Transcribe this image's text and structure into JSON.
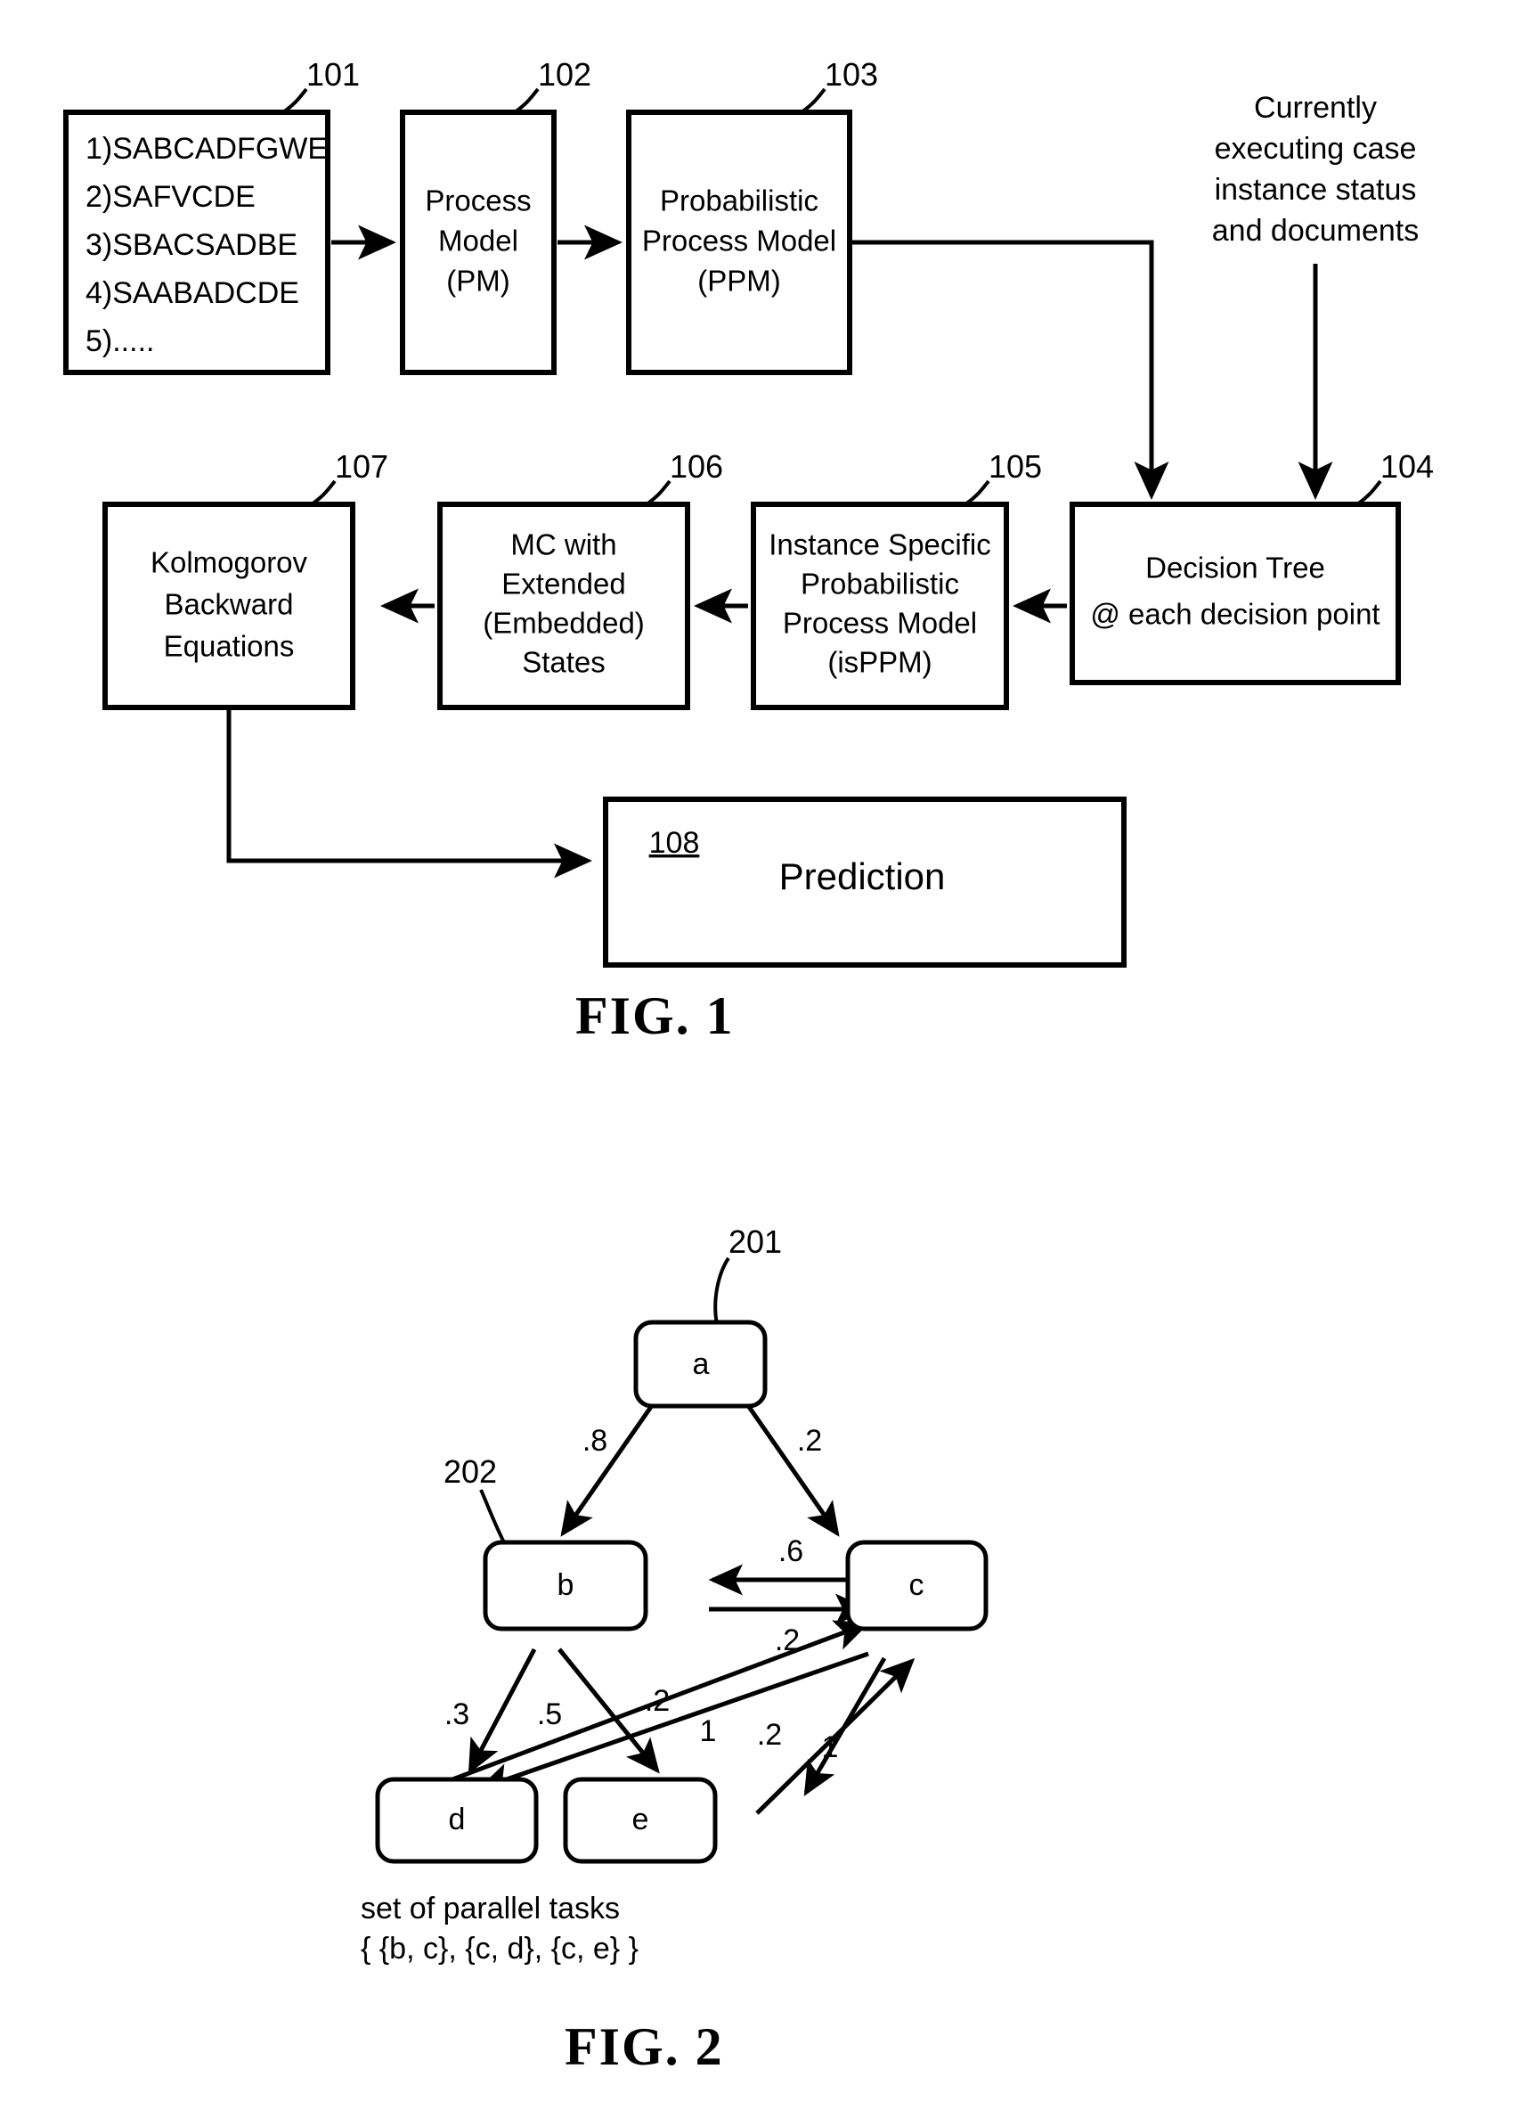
{
  "figure1": {
    "caption": "FIG. 1",
    "blocks": [
      {
        "ref": "101",
        "type": "list",
        "lines": [
          "1)SABCADFGWE",
          "2)SAFVCDE",
          "3)SBACSADBE",
          "4)SAABADCDE",
          "5)....."
        ]
      },
      {
        "ref": "102",
        "type": "box",
        "lines": [
          "Process",
          "Model",
          "(PM)"
        ]
      },
      {
        "ref": "103",
        "type": "box",
        "lines": [
          "Probabilistic",
          "Process Model",
          "(PPM)"
        ]
      },
      {
        "ref": "104",
        "type": "box",
        "lines": [
          "Decision Tree",
          "@ each decision point"
        ]
      },
      {
        "ref": "105",
        "type": "box",
        "lines": [
          "Instance Specific",
          "Probabilistic",
          "Process Model",
          "(isPPM)"
        ]
      },
      {
        "ref": "106",
        "type": "box",
        "lines": [
          "MC with",
          "Extended",
          "(Embedded)",
          "States"
        ]
      },
      {
        "ref": "107",
        "type": "box",
        "lines": [
          "Kolmogorov",
          "Backward",
          "Equations"
        ]
      },
      {
        "ref": "108",
        "type": "box",
        "lines": [
          "Prediction"
        ]
      }
    ],
    "annotation": {
      "lines": [
        "Currently",
        "executing case",
        "instance status",
        "and documents"
      ]
    }
  },
  "figure2": {
    "caption": "FIG. 2",
    "refs": [
      "201",
      "202"
    ],
    "nodes": [
      {
        "id": "a",
        "label": "a",
        "ref": "201"
      },
      {
        "id": "b",
        "label": "b",
        "ref": "202"
      },
      {
        "id": "c",
        "label": "c",
        "ref": ""
      },
      {
        "id": "d",
        "label": "d",
        "ref": ""
      },
      {
        "id": "e",
        "label": "e",
        "ref": ""
      }
    ],
    "edges": [
      {
        "from": "a",
        "to": "b",
        "weight": ".8"
      },
      {
        "from": "a",
        "to": "c",
        "weight": ".2"
      },
      {
        "from": "c",
        "to": "b",
        "weight": ".6"
      },
      {
        "from": "b",
        "to": "c",
        "weight": ".2"
      },
      {
        "from": "b",
        "to": "d",
        "weight": ".3"
      },
      {
        "from": "b",
        "to": "e",
        "weight": ".5"
      },
      {
        "from": "d",
        "to": "c",
        "weight": ".2"
      },
      {
        "from": "e",
        "to": "c",
        "weight": "1"
      },
      {
        "from": "c",
        "to": "e",
        "weight": ".2"
      },
      {
        "from": "c",
        "to": "d",
        "weight": "1"
      }
    ],
    "legend": {
      "line1": "set of parallel tasks",
      "line2": "{ {b, c}, {c, d}, {c, e} }"
    }
  }
}
